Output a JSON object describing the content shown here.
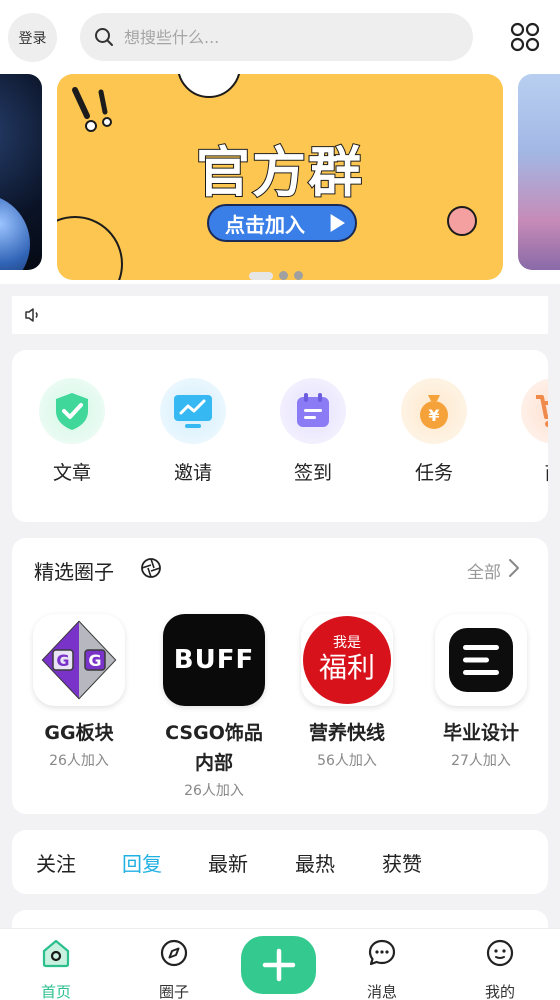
{
  "header": {
    "login_label": "登录",
    "search_placeholder": "想搜些什么..."
  },
  "banner": {
    "title": "官方群",
    "button_label": "点击加入"
  },
  "quick_actions": [
    {
      "label": "文章",
      "icon": "shield-check-icon",
      "color": "#3fd89a"
    },
    {
      "label": "邀请",
      "icon": "monitor-chart-icon",
      "color": "#36b9f2"
    },
    {
      "label": "签到",
      "icon": "calendar-icon",
      "color": "#8b7cf6"
    },
    {
      "label": "任务",
      "icon": "money-bag-icon",
      "color": "#f6a23a"
    },
    {
      "label": "商",
      "icon": "shopping-cart-icon",
      "color": "#f08a4b"
    }
  ],
  "circles": {
    "title": "精选圈子",
    "all_label": "全部",
    "items": [
      {
        "name": "GG板块",
        "members": "26人加入"
      },
      {
        "name": "CSGO饰品内部",
        "members": "26人加入"
      },
      {
        "name": "营养快线",
        "members": "56人加入"
      },
      {
        "name": "毕业设计",
        "members": "27人加入"
      }
    ],
    "logo_text": {
      "buff": "BUFF",
      "fuli_small": "我是",
      "fuli_big": "福利"
    }
  },
  "feed_tabs": [
    {
      "label": "关注",
      "active": false
    },
    {
      "label": "回复",
      "active": true
    },
    {
      "label": "最新",
      "active": false
    },
    {
      "label": "最热",
      "active": false
    },
    {
      "label": "获赞",
      "active": false
    }
  ],
  "bottom_nav": [
    {
      "label": "首页",
      "icon": "home-icon",
      "active": true
    },
    {
      "label": "圈子",
      "icon": "compass-icon",
      "active": false
    },
    {
      "label": "消息",
      "icon": "chat-icon",
      "active": false
    },
    {
      "label": "我的",
      "icon": "face-icon",
      "active": false
    }
  ],
  "colors": {
    "accent_green": "#34c98f",
    "tab_active_blue": "#21b0e3",
    "banner_yellow": "#fcc650",
    "banner_button_blue": "#3a7ee8"
  }
}
